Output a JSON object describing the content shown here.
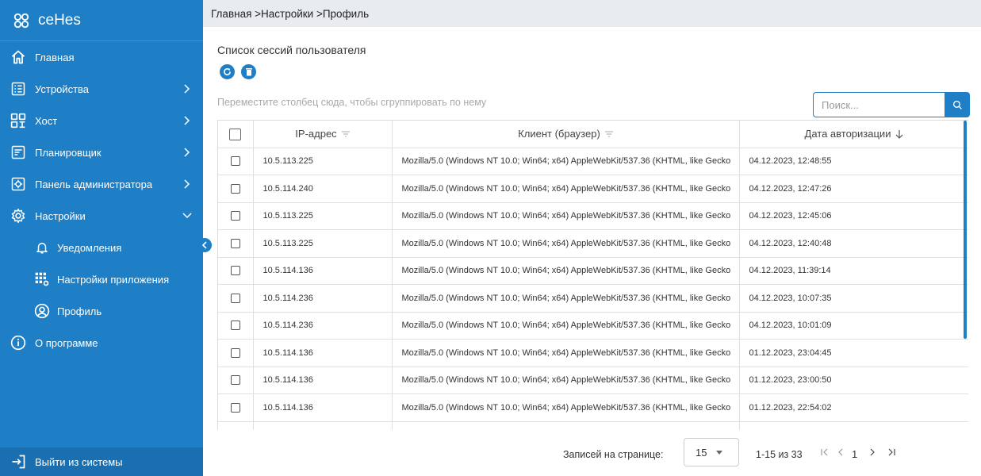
{
  "app": {
    "title": "ceHes"
  },
  "sidebar": {
    "items": [
      {
        "label": "Главная",
        "icon": "home-icon",
        "has_chevron": false
      },
      {
        "label": "Устройства",
        "icon": "devices-icon",
        "has_chevron": true
      },
      {
        "label": "Хост",
        "icon": "host-icon",
        "has_chevron": true
      },
      {
        "label": "Планировщик",
        "icon": "scheduler-icon",
        "has_chevron": true
      },
      {
        "label": "Панель администратора",
        "icon": "admin-panel-icon",
        "has_chevron": true
      },
      {
        "label": "Настройки",
        "icon": "settings-icon",
        "has_chevron": true,
        "expanded": true
      }
    ],
    "subitems": [
      {
        "label": "Уведомления",
        "icon": "bell-icon"
      },
      {
        "label": "Настройки приложения",
        "icon": "app-settings-icon"
      },
      {
        "label": "Профиль",
        "icon": "profile-icon"
      }
    ],
    "about": {
      "label": "О программе",
      "icon": "info-icon"
    },
    "logout": {
      "label": "Выйти из системы",
      "icon": "logout-icon"
    },
    "colors": {
      "background": "#1e7fc7",
      "logout_background": "#1a6fb0"
    }
  },
  "breadcrumb": "Главная >Настройки >Профиль",
  "main": {
    "section_title": "Список сессий пользователя",
    "actions": [
      {
        "name": "refresh-button",
        "icon": "refresh-icon"
      },
      {
        "name": "delete-button",
        "icon": "trash-icon"
      }
    ],
    "group_hint": "Переместите столбец сюда, чтобы сгруппировать по нему",
    "search": {
      "placeholder": "Поиск...",
      "value": ""
    }
  },
  "table": {
    "columns": [
      {
        "label": "IP-адрес",
        "filter": true
      },
      {
        "label": "Клиент (браузер)",
        "filter": true
      },
      {
        "label": "Дата авторизации",
        "sort": "desc"
      }
    ],
    "rows": [
      {
        "ip": "10.5.113.225",
        "client": "Mozilla/5.0 (Windows NT 10.0; Win64; x64) AppleWebKit/537.36 (KHTML, like Gecko",
        "date": "04.12.2023, 12:48:55"
      },
      {
        "ip": "10.5.114.240",
        "client": "Mozilla/5.0 (Windows NT 10.0; Win64; x64) AppleWebKit/537.36 (KHTML, like Gecko",
        "date": "04.12.2023, 12:47:26"
      },
      {
        "ip": "10.5.113.225",
        "client": "Mozilla/5.0 (Windows NT 10.0; Win64; x64) AppleWebKit/537.36 (KHTML, like Gecko",
        "date": "04.12.2023, 12:45:06"
      },
      {
        "ip": "10.5.113.225",
        "client": "Mozilla/5.0 (Windows NT 10.0; Win64; x64) AppleWebKit/537.36 (KHTML, like Gecko",
        "date": "04.12.2023, 12:40:48"
      },
      {
        "ip": "10.5.114.136",
        "client": "Mozilla/5.0 (Windows NT 10.0; Win64; x64) AppleWebKit/537.36 (KHTML, like Gecko",
        "date": "04.12.2023, 11:39:14"
      },
      {
        "ip": "10.5.114.236",
        "client": "Mozilla/5.0 (Windows NT 10.0; Win64; x64) AppleWebKit/537.36 (KHTML, like Gecko",
        "date": "04.12.2023, 10:07:35"
      },
      {
        "ip": "10.5.114.236",
        "client": "Mozilla/5.0 (Windows NT 10.0; Win64; x64) AppleWebKit/537.36 (KHTML, like Gecko",
        "date": "04.12.2023, 10:01:09"
      },
      {
        "ip": "10.5.114.136",
        "client": "Mozilla/5.0 (Windows NT 10.0; Win64; x64) AppleWebKit/537.36 (KHTML, like Gecko",
        "date": "01.12.2023, 23:04:45"
      },
      {
        "ip": "10.5.114.136",
        "client": "Mozilla/5.0 (Windows NT 10.0; Win64; x64) AppleWebKit/537.36 (KHTML, like Gecko",
        "date": "01.12.2023, 23:00:50"
      },
      {
        "ip": "10.5.114.136",
        "client": "Mozilla/5.0 (Windows NT 10.0; Win64; x64) AppleWebKit/537.36 (KHTML, like Gecko",
        "date": "01.12.2023, 22:54:02"
      },
      {
        "ip": "",
        "client": "",
        "date": ""
      }
    ]
  },
  "pager": {
    "per_page_label": "Записей на странице:",
    "per_page_value": "15",
    "range": "1-15 из 33",
    "current_page": "1"
  }
}
